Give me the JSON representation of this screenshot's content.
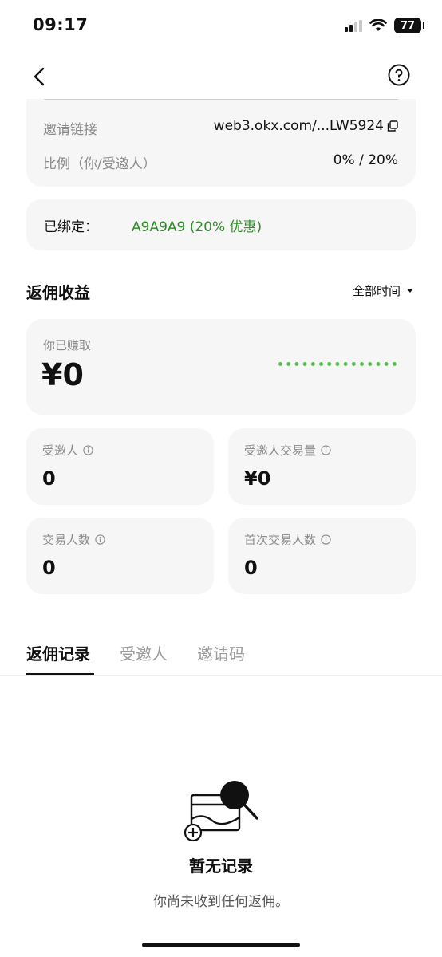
{
  "status_bar": {
    "time": "09:17",
    "battery": "77"
  },
  "invite": {
    "link_label": "邀请链接",
    "link_value": "web3.okx.com/...LW5924",
    "ratio_label": "比例（你/受邀人）",
    "ratio_value": "0% / 20%"
  },
  "bound": {
    "label": "已绑定：",
    "code": "A9A9A9 (20% 优惠)"
  },
  "rebate": {
    "title": "返佣收益",
    "filter": "全部时间",
    "earned_label": "你已赚取",
    "earned_value": "¥0",
    "stats": [
      {
        "label": "受邀人",
        "value": "0"
      },
      {
        "label": "受邀人交易量",
        "value": "¥0"
      },
      {
        "label": "交易人数",
        "value": "0"
      },
      {
        "label": "首次交易人数",
        "value": "0"
      }
    ]
  },
  "tabs": [
    {
      "label": "返佣记录",
      "active": true
    },
    {
      "label": "受邀人",
      "active": false
    },
    {
      "label": "邀请码",
      "active": false
    }
  ],
  "empty": {
    "title": "暂无记录",
    "description": "你尚未收到任何返佣。"
  },
  "colors": {
    "accent_green": "#2f8a2a",
    "chart_green": "#5cbf55",
    "card_bg": "#f6f6f6"
  }
}
